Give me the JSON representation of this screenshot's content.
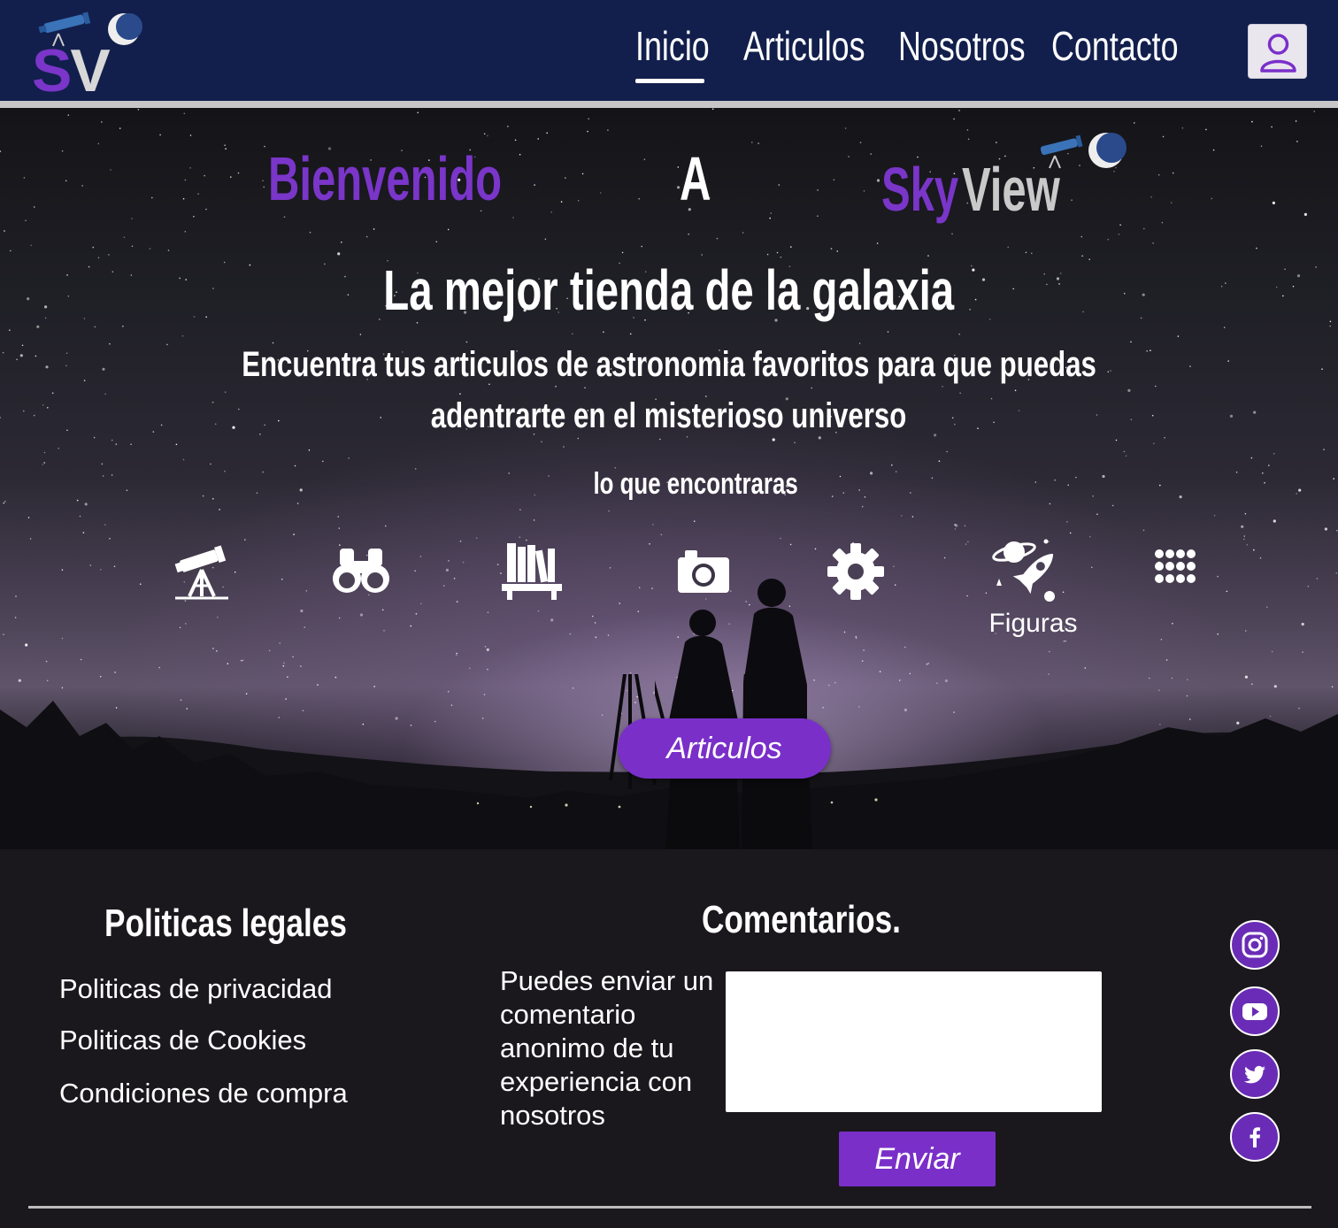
{
  "brand": {
    "logo_s": "S",
    "logo_v": "V"
  },
  "nav": {
    "links": [
      {
        "label": "Inicio",
        "active": true
      },
      {
        "label": "Articulos",
        "active": false
      },
      {
        "label": "Nosotros",
        "active": false
      },
      {
        "label": "Contacto",
        "active": false
      }
    ],
    "user_icon": "user-icon"
  },
  "hero": {
    "welcome": {
      "word1": "Bienvenido",
      "word2": "A",
      "brand_sky": "Sky",
      "brand_view": "View"
    },
    "tagline": "La mejor tienda de la galaxia",
    "subtitle_line1": "Encuentra tus articulos de astronomia favoritos para que puedas",
    "subtitle_line2": "adentrarte en el misterioso universo",
    "find_text": "lo que encontraras",
    "categories": [
      {
        "icon": "telescope-icon",
        "label": ""
      },
      {
        "icon": "binoculars-icon",
        "label": ""
      },
      {
        "icon": "books-icon",
        "label": ""
      },
      {
        "icon": "camera-icon",
        "label": ""
      },
      {
        "icon": "gear-icon",
        "label": ""
      },
      {
        "icon": "rocket-planet-icon",
        "label": "Figuras"
      },
      {
        "icon": "grid-dots-icon",
        "label": ""
      }
    ],
    "cta_label": "Articulos"
  },
  "footer": {
    "legal_title": "Politicas legales",
    "legal_links": [
      "Politicas de privacidad",
      "Politicas de Cookies",
      "Condiciones de compra"
    ],
    "comments_title": "Comentarios.",
    "comments_desc": "Puedes enviar un comentario anonimo de tu experiencia con nosotros",
    "comments_value": "",
    "send_label": "Enviar",
    "social": [
      "instagram-icon",
      "youtube-icon",
      "twitter-icon",
      "facebook-icon"
    ]
  },
  "colors": {
    "accent": "#7a2fc9",
    "nav_bg": "#121f4c",
    "footer_bg": "#1a181d"
  }
}
